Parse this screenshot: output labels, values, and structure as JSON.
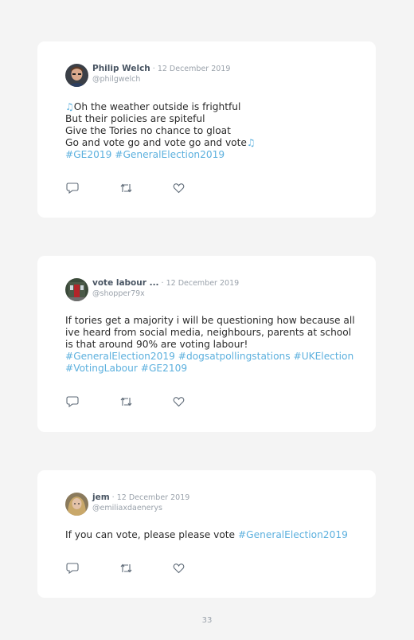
{
  "colors": {
    "background": "#f4f4f4",
    "card": "#ffffff",
    "name": "#495563",
    "muted": "#9aa2ab",
    "hashtag": "#5cb0de",
    "text": "#2b2b2b"
  },
  "tweets": [
    {
      "name": "Philip Welch",
      "date": "· 12 December 2019",
      "handle": "@philgwelch",
      "lines": [
        "Oh the weather outside is frightful",
        "But their policies are spiteful",
        "Give the Tories no chance to gloat",
        "Go and vote go and vote go and vote"
      ],
      "music_note": "♫",
      "hashtags": "#GE2019 #GeneralElection2019"
    },
    {
      "name": "vote labour ...",
      "date": "· 12 December 2019",
      "handle": "@shopper79x",
      "lines": [
        "If tories get a majority i will be questioning how because all",
        "ive heard from social media, neighbours, parents at school",
        "is that around 90% are voting labour!"
      ],
      "hashtags": "#GeneralElection2019 #dogsatpollingstations #UKElection",
      "hashtags2": "#VotingLabour #GE2109"
    },
    {
      "name": "jem",
      "date": "· 12 December 2019",
      "handle": "@emiliaxdaenerys",
      "text": "If you can vote, please please vote ",
      "inline_hashtag": "#GeneralElection2019"
    }
  ],
  "icons": [
    "reply-icon",
    "retweet-icon",
    "like-icon"
  ],
  "page_number": "33"
}
